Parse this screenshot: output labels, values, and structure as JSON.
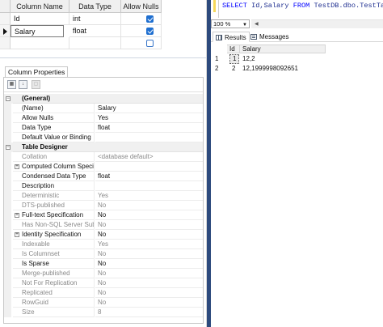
{
  "column_grid": {
    "headers": [
      "Column Name",
      "Data Type",
      "Allow Nulls"
    ],
    "rows": [
      {
        "name": "Id",
        "type": "int",
        "allow_nulls": true,
        "current": false
      },
      {
        "name": "Salary",
        "type": "float",
        "allow_nulls": true,
        "current": true
      },
      {
        "name": "",
        "type": "",
        "allow_nulls": false,
        "current": false
      }
    ]
  },
  "column_properties": {
    "tab_label": "Column Properties",
    "toolbar_icons": [
      "categorized-icon",
      "alphabetical-icon",
      "property-pages-icon"
    ],
    "properties": [
      {
        "kind": "category",
        "name": "(General)"
      },
      {
        "kind": "prop",
        "name": "(Name)",
        "value": "Salary"
      },
      {
        "kind": "prop",
        "name": "Allow Nulls",
        "value": "Yes"
      },
      {
        "kind": "prop",
        "name": "Data Type",
        "value": "float"
      },
      {
        "kind": "prop",
        "name": "Default Value or Binding",
        "value": ""
      },
      {
        "kind": "category",
        "name": "Table Designer"
      },
      {
        "kind": "prop",
        "name": "Collation",
        "value": "<database default>",
        "disabled": true
      },
      {
        "kind": "prop",
        "name": "Computed Column Specif",
        "value": "",
        "expandable": true
      },
      {
        "kind": "prop",
        "name": "Condensed Data Type",
        "value": "float"
      },
      {
        "kind": "prop",
        "name": "Description",
        "value": ""
      },
      {
        "kind": "prop",
        "name": "Deterministic",
        "value": "Yes",
        "disabled": true
      },
      {
        "kind": "prop",
        "name": "DTS-published",
        "value": "No",
        "disabled": true
      },
      {
        "kind": "prop",
        "name": "Full-text Specification",
        "value": "No",
        "expandable": true
      },
      {
        "kind": "prop",
        "name": "Has Non-SQL Server Subs",
        "value": "No",
        "disabled": true
      },
      {
        "kind": "prop",
        "name": "Identity Specification",
        "value": "No",
        "expandable": true
      },
      {
        "kind": "prop",
        "name": "Indexable",
        "value": "Yes",
        "disabled": true
      },
      {
        "kind": "prop",
        "name": "Is Columnset",
        "value": "No",
        "disabled": true
      },
      {
        "kind": "prop",
        "name": "Is Sparse",
        "value": "No"
      },
      {
        "kind": "prop",
        "name": "Merge-published",
        "value": "No",
        "disabled": true
      },
      {
        "kind": "prop",
        "name": "Not For Replication",
        "value": "No",
        "disabled": true
      },
      {
        "kind": "prop",
        "name": "Replicated",
        "value": "No",
        "disabled": true
      },
      {
        "kind": "prop",
        "name": "RowGuid",
        "value": "No",
        "disabled": true
      },
      {
        "kind": "prop",
        "name": "Size",
        "value": "8",
        "disabled": true
      }
    ]
  },
  "query_editor": {
    "keyword_select": "SELECT",
    "columns": " Id,Salary ",
    "keyword_from": "FROM",
    "table": " TestDB.dbo.TestTable"
  },
  "zoom": {
    "value": "100 %"
  },
  "result_tabs": [
    {
      "label": "Results",
      "icon": "results-grid-icon",
      "active": true
    },
    {
      "label": "Messages",
      "icon": "messages-icon",
      "active": false
    }
  ],
  "results": {
    "headers": [
      "Id",
      "Salary"
    ],
    "rows": [
      {
        "num": "1",
        "id": "1",
        "salary": "12,2"
      },
      {
        "num": "2",
        "id": "2",
        "salary": "12,1999998092651"
      }
    ]
  },
  "colors": {
    "divider": "#2d4a7d",
    "keyword": "#0000ff",
    "checkbox": "#1f6fd0"
  }
}
